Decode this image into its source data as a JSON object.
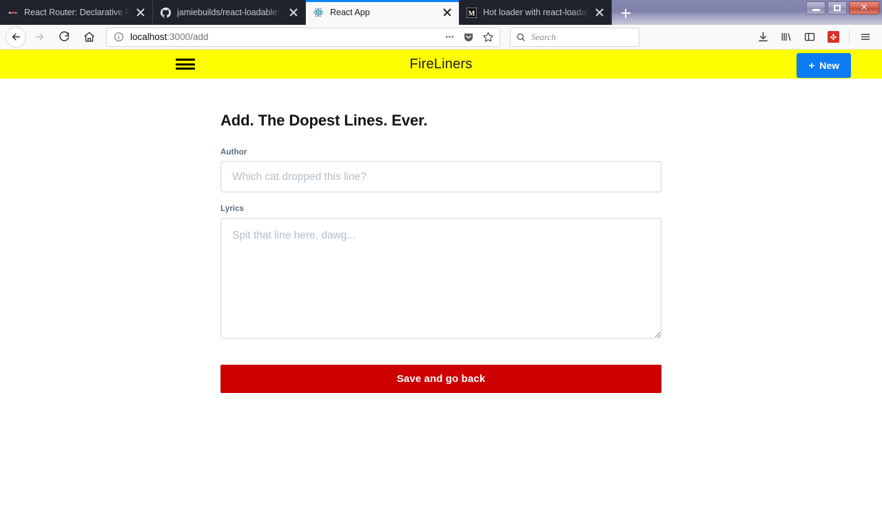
{
  "browser": {
    "tabs": [
      {
        "title": "React Router: Declarative Routi",
        "favicon": "react-router-icon",
        "active": false
      },
      {
        "title": "jamiebuilds/react-loadable: A h",
        "favicon": "github-icon",
        "active": false
      },
      {
        "title": "React App",
        "favicon": "react-icon",
        "active": true
      },
      {
        "title": "Hot loader with react-loadable",
        "favicon": "medium-icon",
        "active": false
      }
    ],
    "new_tab_label": "+",
    "window_controls": {
      "minimize": "–",
      "maximize": "❐",
      "close": "✕"
    },
    "nav": {
      "back_label": "Back",
      "forward_label": "Forward",
      "reload_label": "Reload",
      "home_label": "Home"
    },
    "url": {
      "host": "localhost",
      "path": ":3000/add",
      "full": "localhost:3000/add"
    },
    "url_actions": {
      "page_actions": "…",
      "pocket": "pocket-icon",
      "bookmark": "star-icon"
    },
    "search": {
      "placeholder": "Search"
    },
    "toolbar_right": {
      "downloads": "downloads-icon",
      "library": "library-icon",
      "sidebar": "sidebar-icon",
      "extension": "extension-icon",
      "menu": "hamburger-menu-icon"
    }
  },
  "app": {
    "header": {
      "menu_label": "Menu",
      "title": "FireLiners",
      "new_button": {
        "icon": "+",
        "label": "New"
      },
      "background_color": "#ffff00",
      "new_button_color": "#0c7cf5"
    },
    "main": {
      "page_title": "Add. The Dopest Lines. Ever.",
      "fields": [
        {
          "label": "Author",
          "placeholder": "Which cat dropped this line?",
          "value": "",
          "type": "text"
        },
        {
          "label": "Lyrics",
          "placeholder": "Spit that line here, dawg...",
          "value": "",
          "type": "textarea"
        }
      ],
      "submit": {
        "label": "Save and go back",
        "color": "#cc0000"
      }
    }
  }
}
